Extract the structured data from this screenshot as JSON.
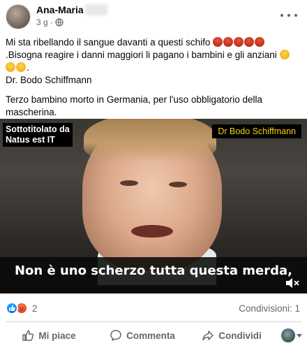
{
  "post": {
    "author": "Ana-Maria",
    "time": "3 g",
    "dot": "·",
    "text_lines": [
      "Mi sta ribellando il sangue davanti a questi schifo",
      ".Bisogna reagire i danni maggiori li pagano i bambini e gli anziani",
      "Dr. Bodo Schiffmann",
      "Terzo bambino morto in Germania, per l'uso obbligatorio della mascherina."
    ]
  },
  "video": {
    "subtitle_credit_line1": "Sottotitolato da",
    "subtitle_credit_line2": "Natus est IT",
    "speaker_name": "Dr Bodo Schiffmann",
    "caption": "Non è uno scherzo tutta questa merda,"
  },
  "engagement": {
    "reaction_count": "2",
    "shares": "Condivisioni: 1"
  },
  "actions": {
    "like": "Mi piace",
    "comment": "Commenta",
    "share": "Condividi"
  },
  "icons": [
    "globe-icon",
    "more-icon",
    "like-icon",
    "comment-icon",
    "share-icon",
    "mute-icon",
    "angry-reaction-icon",
    "like-reaction-icon"
  ],
  "colors": {
    "accent": "#0866ff",
    "secondary_text": "#65676b",
    "speaker_name": "#f5d016"
  }
}
